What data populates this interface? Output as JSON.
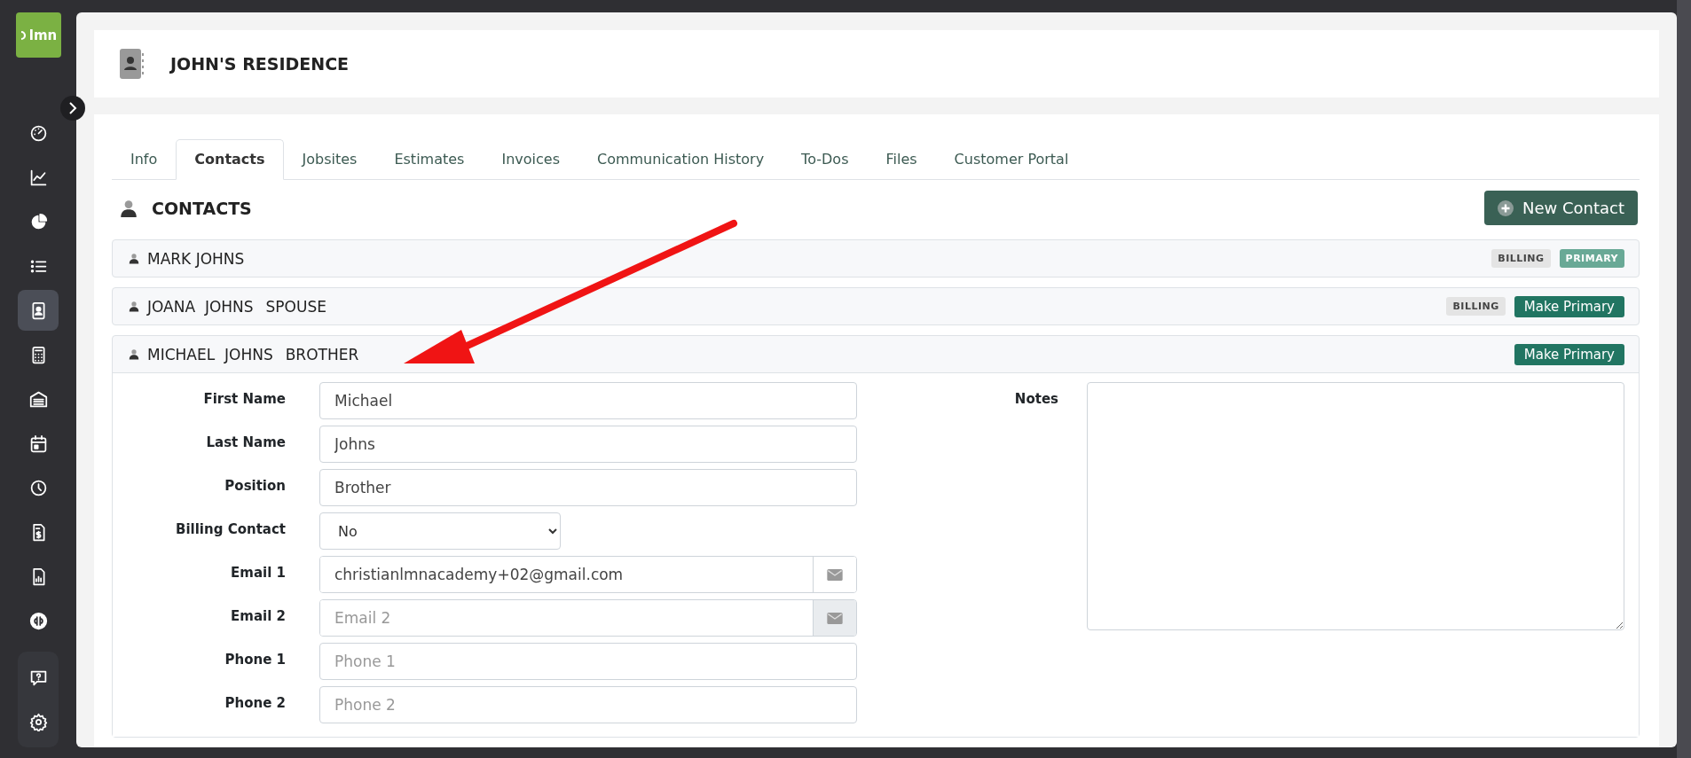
{
  "sidebar": {
    "logo": "lmn",
    "nav": [
      {
        "kind": "gauge",
        "selected": false
      },
      {
        "kind": "line-chart",
        "selected": false
      },
      {
        "kind": "pie-chart",
        "selected": false
      },
      {
        "kind": "list",
        "selected": false
      },
      {
        "kind": "contact-card",
        "selected": true
      },
      {
        "kind": "calculator",
        "selected": false
      },
      {
        "kind": "garage",
        "selected": false
      },
      {
        "kind": "calendar",
        "selected": false
      },
      {
        "kind": "clock",
        "selected": false
      },
      {
        "kind": "invoice",
        "selected": false
      },
      {
        "kind": "report",
        "selected": false
      },
      {
        "kind": "qb",
        "selected": false
      }
    ],
    "bottom": [
      {
        "kind": "help"
      },
      {
        "kind": "settings"
      }
    ]
  },
  "header": {
    "title": "JOHN'S RESIDENCE"
  },
  "tabs": [
    {
      "label": "Info",
      "selected": false
    },
    {
      "label": "Contacts",
      "selected": true
    },
    {
      "label": "Jobsites",
      "selected": false
    },
    {
      "label": "Estimates",
      "selected": false
    },
    {
      "label": "Invoices",
      "selected": false
    },
    {
      "label": "Communication History",
      "selected": false
    },
    {
      "label": "To-Dos",
      "selected": false
    },
    {
      "label": "Files",
      "selected": false
    },
    {
      "label": "Customer Portal",
      "selected": false
    }
  ],
  "section": {
    "title": "CONTACTS",
    "new_button": "New Contact"
  },
  "contacts": [
    {
      "name": "MARK JOHNS",
      "expanded": false,
      "badges": [
        {
          "kind": "billing",
          "label": "BILLING"
        },
        {
          "kind": "primary",
          "label": "PRIMARY"
        }
      ]
    },
    {
      "name": "JOANA  JOHNS",
      "relation": "SPOUSE",
      "expanded": false,
      "badges": [
        {
          "kind": "billing",
          "label": "BILLING"
        }
      ],
      "action": "Make Primary"
    },
    {
      "name": "MICHAEL  JOHNS",
      "relation": "BROTHER",
      "expanded": true,
      "action": "Make Primary",
      "details": {
        "fields": [
          {
            "kind": "text",
            "label": "First Name",
            "value": "Michael"
          },
          {
            "kind": "text",
            "label": "Last Name",
            "value": "Johns"
          },
          {
            "kind": "text",
            "label": "Position",
            "value": "Brother"
          },
          {
            "kind": "select",
            "label": "Billing Contact",
            "value": "No"
          },
          {
            "kind": "email",
            "label": "Email 1",
            "value": "christianlmnacademy+02@gmail.com"
          },
          {
            "kind": "email",
            "label": "Email 2",
            "placeholder": "Email 2"
          },
          {
            "kind": "text",
            "label": "Phone 1",
            "placeholder": "Phone 1"
          },
          {
            "kind": "text",
            "label": "Phone 2",
            "placeholder": "Phone 2"
          }
        ],
        "notes_label": "Notes"
      }
    }
  ]
}
